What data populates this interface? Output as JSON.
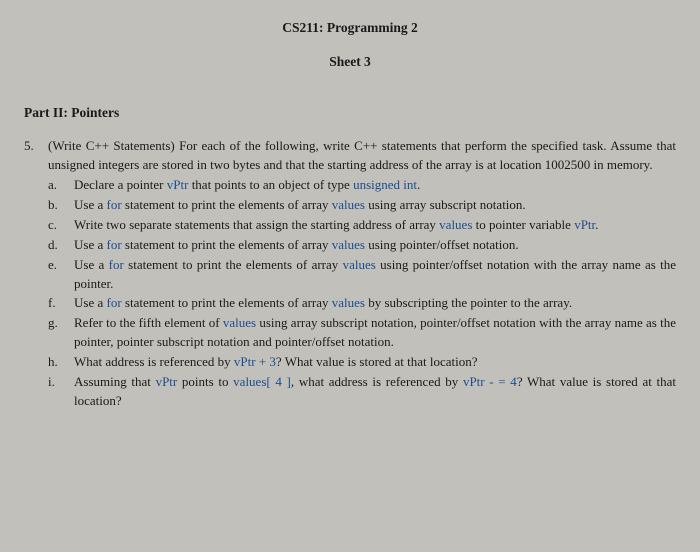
{
  "header": {
    "course": "CS211: Programming 2",
    "sheet": "Sheet 3"
  },
  "part_title": "Part II: Pointers",
  "question": {
    "number": "5.",
    "intro_a": "(Write C++ Statements) For each of the following, write C++ statements that perform the specified task. Assume that unsigned integers are stored in two bytes and that the starting address of the array is at location 1002500 in memory.",
    "items": [
      {
        "label": "a.",
        "pre": "Declare a pointer ",
        "c1": "vPtr",
        "mid1": " that points to an object of type ",
        "c2": "unsigned int",
        "post": "."
      },
      {
        "label": "b.",
        "pre": "Use a ",
        "c1": "for",
        "mid1": " statement to print the elements of array ",
        "c2": "values",
        "post": " using array subscript notation."
      },
      {
        "label": "c.",
        "pre": "Write two separate statements that assign the starting address of array ",
        "c1": "values",
        "mid1": " to pointer variable ",
        "c2": "vPtr",
        "post": "."
      },
      {
        "label": "d.",
        "pre": "Use a ",
        "c1": "for",
        "mid1": " statement to print the elements of array ",
        "c2": "values",
        "post": " using pointer/offset notation."
      },
      {
        "label": "e.",
        "pre": "Use a ",
        "c1": "for",
        "mid1": " statement to print the elements of array ",
        "c2": "values",
        "post": " using pointer/offset notation with the array name as the pointer."
      },
      {
        "label": "f.",
        "pre": "Use a ",
        "c1": "for",
        "mid1": " statement to print the elements of array ",
        "c2": "values",
        "post": " by subscripting the pointer to the array."
      },
      {
        "label": "g.",
        "pre": "Refer to the fifth element of ",
        "c1": "values",
        "mid1": " using array subscript notation, pointer/offset notation with the array name as the pointer, pointer subscript notation and pointer/offset notation.",
        "c2": "",
        "post": ""
      },
      {
        "label": "h.",
        "pre": "What address is referenced by ",
        "c1": "vPtr + 3",
        "mid1": "? What value is stored at that location?",
        "c2": "",
        "post": ""
      },
      {
        "label": "i.",
        "pre": "Assuming that ",
        "c1": "vPtr",
        "mid1": " points to ",
        "c2": "values[ 4 ]",
        "post": ", what address is referenced by ",
        "c3": "vPtr - = 4",
        "tail": "? What value is stored at that location?"
      }
    ]
  }
}
